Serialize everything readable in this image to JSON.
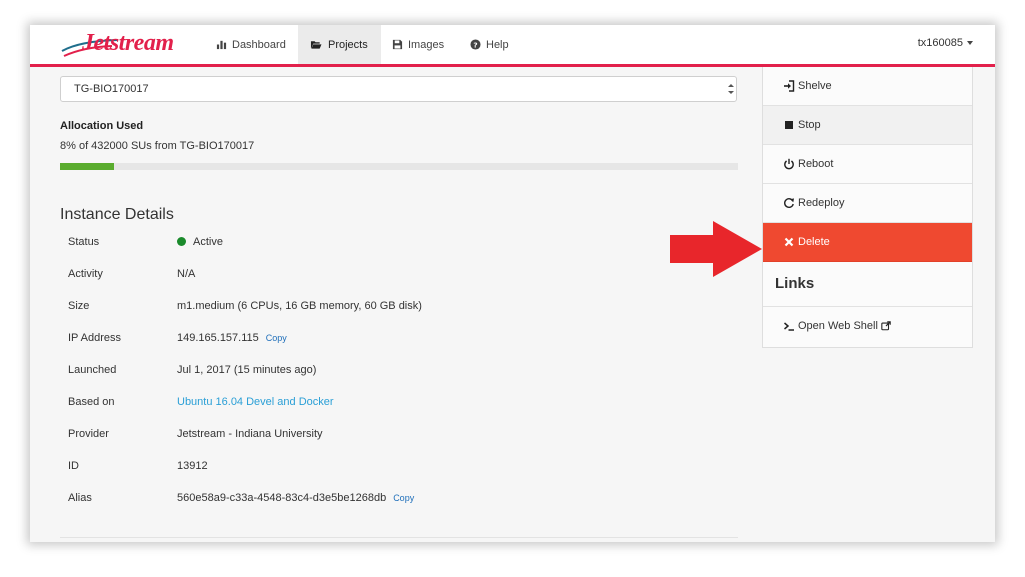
{
  "navbar": {
    "logo_text": "Jetstream",
    "items": [
      {
        "label": "Dashboard",
        "icon": "bar-chart-icon",
        "active": false
      },
      {
        "label": "Projects",
        "icon": "folder-open-icon",
        "active": true
      },
      {
        "label": "Images",
        "icon": "floppy-disk-icon",
        "active": false
      },
      {
        "label": "Help",
        "icon": "question-circle-icon",
        "active": false
      }
    ],
    "user": "tx160085"
  },
  "project_select": {
    "value": "TG-BIO170017"
  },
  "allocation": {
    "title": "Allocation Used",
    "text": "8% of 432000 SUs from TG-BIO170017",
    "used_fraction": 0.08,
    "bar_color": "#5aac2e"
  },
  "instance_details": {
    "title": "Instance Details",
    "rows": [
      {
        "label": "Status",
        "value": "Active"
      },
      {
        "label": "Activity",
        "value": "N/A"
      },
      {
        "label": "Size",
        "value": "m1.medium (6 CPUs, 16 GB memory, 60 GB disk)"
      },
      {
        "label": "IP Address",
        "value": "149.165.157.115",
        "copy": "Copy"
      },
      {
        "label": "Launched",
        "value": "Jul 1, 2017 (15 minutes ago)"
      },
      {
        "label": "Based on",
        "value": "Ubuntu 16.04 Devel and Docker"
      },
      {
        "label": "Provider",
        "value": "Jetstream - Indiana University"
      },
      {
        "label": "ID",
        "value": "13912"
      },
      {
        "label": "Alias",
        "value": "560e58a9-c33a-4548-83c4-d3e5be1268db",
        "copy": "Copy"
      }
    ]
  },
  "actions": {
    "items": [
      {
        "label": "Shelve",
        "icon": "sign-in-icon"
      },
      {
        "label": "Stop",
        "icon": "stop-icon"
      },
      {
        "label": "Reboot",
        "icon": "power-icon"
      },
      {
        "label": "Redeploy",
        "icon": "refresh-icon"
      },
      {
        "label": "Delete",
        "icon": "close-icon"
      }
    ],
    "links_title": "Links",
    "web_shell": "Open Web Shell"
  },
  "colors": {
    "brand": "#e2204b",
    "delete": "#ef4930",
    "link": "#2a9fd6",
    "status_active": "#1a8a2b",
    "annotation_arrow": "#e8262b"
  }
}
